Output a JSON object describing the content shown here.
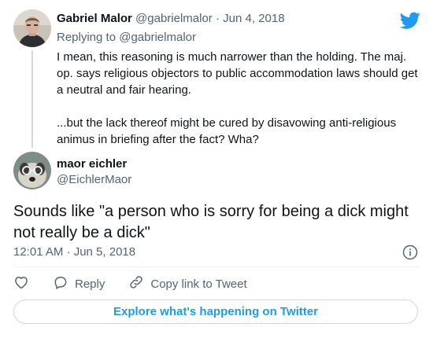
{
  "parent_tweet": {
    "author_name": "Gabriel Malor",
    "author_handle": "@gabrielmalor",
    "separator": "·",
    "date": "Jun 4, 2018",
    "replying_prefix": "Replying to",
    "replying_to": "@gabrielmalor",
    "paragraphs": [
      "I mean, this reasoning is much narrower than the holding. The maj. op. says religious objectors to public accommodation laws should get a neutral and fair hearing.",
      "...but the lack thereof might be cured by disavowing anti-religious animus in briefing after the fact? Wha?"
    ]
  },
  "main_tweet": {
    "author_name": "maor eichler",
    "author_handle": "@EichlerMaor",
    "text": "Sounds like \"a person who is sorry for being a dick might not really be a dick\"",
    "timestamp": "12:01 AM · Jun 5, 2018"
  },
  "actions": {
    "reply_label": "Reply",
    "copy_link_label": "Copy link to Tweet"
  },
  "explore_label": "Explore what's happening on Twitter",
  "colors": {
    "accent": "#1d9bf0",
    "secondary_text": "#536471",
    "primary_text": "#0f1419",
    "border": "#cfd9de"
  },
  "icons": [
    "twitter-bird-icon",
    "info-icon",
    "heart-icon",
    "reply-bubble-icon",
    "link-icon"
  ]
}
